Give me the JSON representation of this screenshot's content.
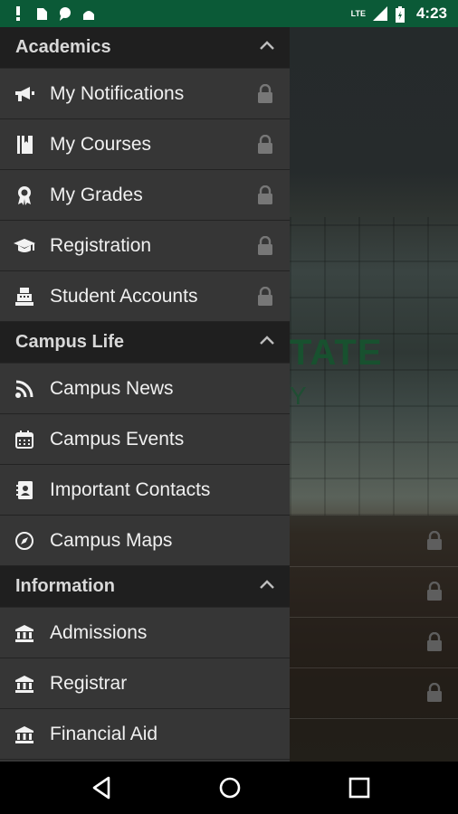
{
  "status_bar": {
    "time": "4:23",
    "network": "LTE"
  },
  "background": {
    "logo_text": "TATE",
    "logo_sub": "Y",
    "rows": [
      {
        "locked": true
      },
      {
        "locked": true
      },
      {
        "locked": true
      },
      {
        "locked": true
      }
    ]
  },
  "drawer": {
    "sections": [
      {
        "title": "Academics",
        "items": [
          {
            "label": "My Notifications",
            "icon": "megaphone-icon",
            "locked": true
          },
          {
            "label": "My Courses",
            "icon": "book-icon",
            "locked": true
          },
          {
            "label": "My Grades",
            "icon": "award-icon",
            "locked": true
          },
          {
            "label": "Registration",
            "icon": "graduation-cap-icon",
            "locked": true
          },
          {
            "label": "Student Accounts",
            "icon": "cash-register-icon",
            "locked": true
          }
        ]
      },
      {
        "title": "Campus Life",
        "items": [
          {
            "label": "Campus News",
            "icon": "rss-icon",
            "locked": false
          },
          {
            "label": "Campus Events",
            "icon": "calendar-icon",
            "locked": false
          },
          {
            "label": "Important Contacts",
            "icon": "contacts-icon",
            "locked": false
          },
          {
            "label": "Campus Maps",
            "icon": "compass-icon",
            "locked": false
          }
        ]
      },
      {
        "title": "Information",
        "items": [
          {
            "label": "Admissions",
            "icon": "bank-icon",
            "locked": false
          },
          {
            "label": "Registrar",
            "icon": "bank-icon",
            "locked": false
          },
          {
            "label": "Financial Aid",
            "icon": "bank-icon",
            "locked": false
          }
        ]
      }
    ]
  },
  "colors": {
    "status_bar": "#0b5a37",
    "drawer": "#363636",
    "section_header": "#1f1f1f",
    "text": "#f0f0f0"
  }
}
